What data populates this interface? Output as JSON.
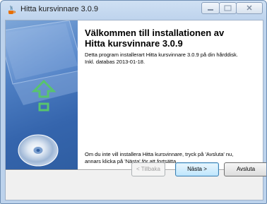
{
  "window": {
    "title": "Hitta kursvinnare 3.0.9",
    "controls": {
      "minimize_icon": "minimize-icon",
      "maximize_icon": "maximize-icon",
      "close_icon": "close-icon"
    }
  },
  "main": {
    "heading_line1": "Välkommen till installationen av",
    "heading_line2": "Hitta kursvinnare 3.0.9",
    "description_line1": "Detta program installerart Hitta kursvinnare 3.0.9 på din hårddisk.",
    "description_line2": "Inkl. databas 2013-01-18.",
    "footer_line1": "Om du inte vill installera Hitta kursvinnare, tryck på 'Avsluta' nu,",
    "footer_line2": "annars klicka på 'Nästa' för att fortsätta."
  },
  "buttons": {
    "back": "< Tillbaka",
    "next": "Nästa >",
    "cancel": "Avsluta"
  },
  "colors": {
    "side_panel": "#3565ad",
    "arrow": "#58c46c"
  }
}
